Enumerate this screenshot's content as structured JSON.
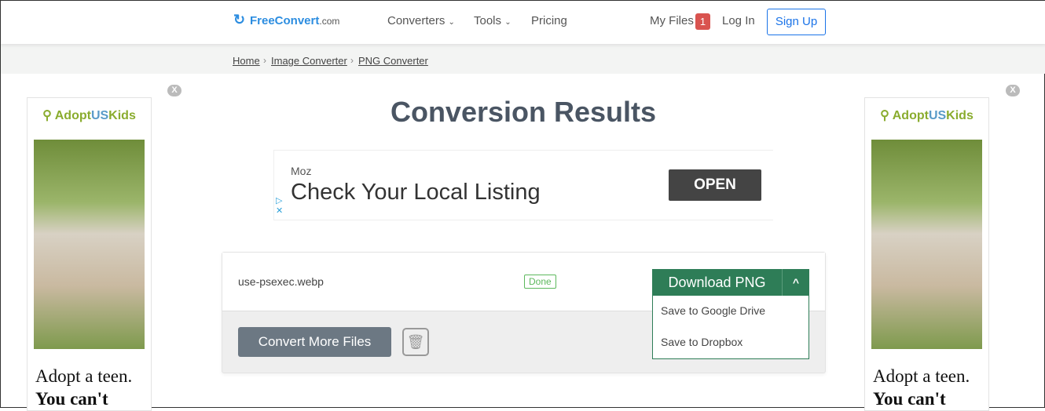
{
  "header": {
    "logo_main": "FreeConvert",
    "logo_suffix": ".com",
    "nav": [
      "Converters",
      "Tools",
      "Pricing"
    ],
    "my_files": "My Files",
    "my_files_count": "1",
    "login": "Log In",
    "signup": "Sign Up"
  },
  "breadcrumb": [
    "Home",
    "Image Converter",
    "PNG Converter"
  ],
  "page_title": "Conversion Results",
  "top_ad": {
    "advertiser": "Moz",
    "headline": "Check Your Local Listing",
    "cta": "OPEN"
  },
  "side_ad": {
    "logo_a": "Adopt",
    "logo_b": "US",
    "logo_c": "Kids",
    "line1": "Adopt a teen.",
    "line2": "You can't",
    "close": "X"
  },
  "file": {
    "name": "use-psexec.webp",
    "status": "Done",
    "download": "Download PNG",
    "options": [
      "Save to Google Drive",
      "Save to Dropbox"
    ]
  },
  "actions": {
    "convert_more": "Convert More Files"
  },
  "colors": {
    "accent": "#2e7d57",
    "primary": "#1a73e8",
    "badge": "#d9534f"
  }
}
